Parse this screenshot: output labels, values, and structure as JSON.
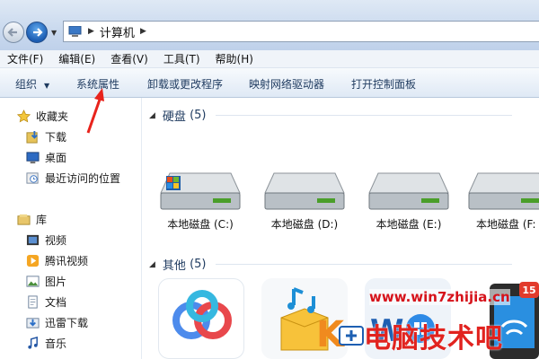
{
  "address": {
    "location": "计算机"
  },
  "menubar": {
    "items": [
      "文件(F)",
      "编辑(E)",
      "查看(V)",
      "工具(T)",
      "帮助(H)"
    ]
  },
  "commandbar": {
    "organize": "组织",
    "system_properties": "系统属性",
    "uninstall": "卸载或更改程序",
    "map_drive": "映射网络驱动器",
    "control_panel": "打开控制面板"
  },
  "sidebar": {
    "favorites": {
      "label": "收藏夹",
      "items": [
        "下载",
        "桌面",
        "最近访问的位置"
      ]
    },
    "libraries": {
      "label": "库",
      "items": [
        "视频",
        "腾讯视频",
        "图片",
        "文档",
        "迅雷下载",
        "音乐"
      ]
    }
  },
  "groups": {
    "hard_disks": {
      "title": "硬盘",
      "count": "(5)"
    },
    "other": {
      "title": "其他",
      "count": "(5)"
    }
  },
  "drives": [
    "本地磁盘 (C:)",
    "本地磁盘 (D:)",
    "本地磁盘 (E:)",
    "本地磁盘 (F:"
  ],
  "watermark": {
    "url": "www.win7zhijia.cn",
    "text": "电脑技术吧",
    "badge": "15"
  },
  "colors": {
    "accent": "#1c5db3",
    "arrow": "#e8231c",
    "watermark": "#e1231f"
  }
}
